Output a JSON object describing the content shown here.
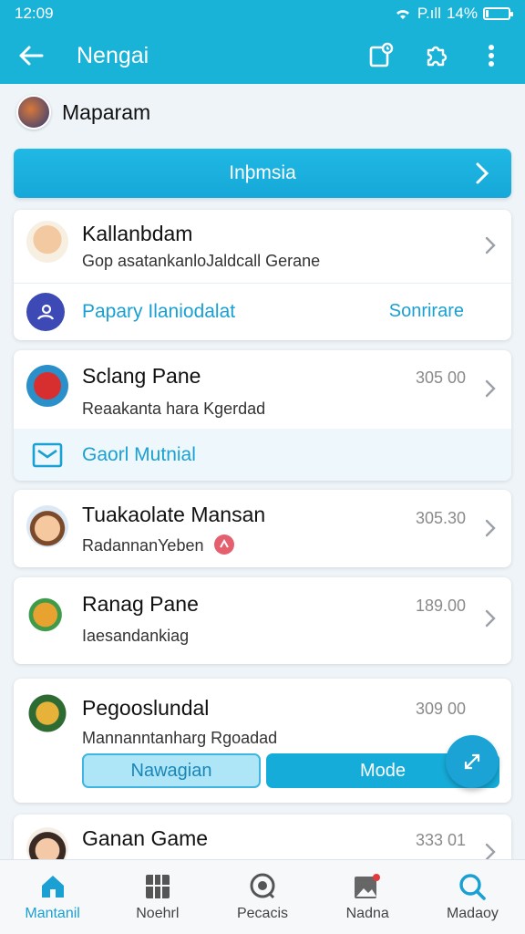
{
  "status": {
    "time": "12:09",
    "signal": "P.ıll",
    "battery": "14%",
    "battery_level": 0.14
  },
  "appbar": {
    "title": "Nengai"
  },
  "profile": {
    "name": "Maparam"
  },
  "banner": {
    "label": "Inþmsia"
  },
  "items": [
    {
      "title": "Kallanbdam",
      "subtitle": "Gop asatankanloJaldcall Gerane",
      "sub_label": "Papary Ilaniodalat",
      "sub_action": "Sonrirare"
    },
    {
      "title": "Sclang Pane",
      "subtitle": "Reaakanta hara Kgerdad",
      "time": "305 00",
      "sub_label": "Gaorl Mutnial"
    },
    {
      "title": "Tuakaolate Mansan",
      "subtitle": "RadannanYeben",
      "time": "305.30"
    },
    {
      "title": "Ranag Pane",
      "subtitle": "Iaesandankiag",
      "time": "189.00"
    },
    {
      "title": "Pegooslundal",
      "subtitle": "Mannanntanharg Rgoadad",
      "time": "309 00",
      "button_outline": "Nawagian",
      "button_solid": "Mode"
    },
    {
      "title": "Ganan Game",
      "time": "333 01"
    }
  ],
  "nav": [
    {
      "label": "Mantanil",
      "icon": "home-icon"
    },
    {
      "label": "Noehrl",
      "icon": "grid-icon"
    },
    {
      "label": "Pecacis",
      "icon": "target-icon"
    },
    {
      "label": "Nadna",
      "icon": "image-badge-icon"
    },
    {
      "label": "Madaoy",
      "icon": "search-icon"
    }
  ],
  "colors": {
    "primary": "#1ab3d8",
    "accent": "#1aa0d3",
    "background": "#eef4f8"
  }
}
